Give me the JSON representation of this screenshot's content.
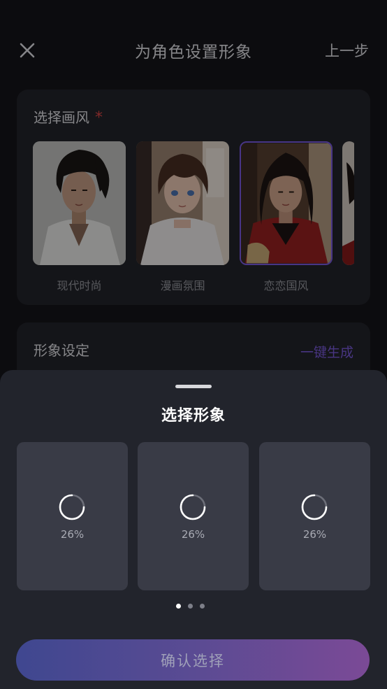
{
  "header": {
    "title": "为角色设置形象",
    "prev_label": "上一步"
  },
  "style_section": {
    "title": "选择画风",
    "required_mark": "*",
    "styles": [
      {
        "label": "现代时尚",
        "selected": false
      },
      {
        "label": "漫画氛围",
        "selected": false
      },
      {
        "label": "恋恋国风",
        "selected": true
      }
    ]
  },
  "appearance_section": {
    "title": "形象设定",
    "generate_label": "一键生成"
  },
  "sheet": {
    "title": "选择形象",
    "options": [
      {
        "progress": "26%"
      },
      {
        "progress": "26%"
      },
      {
        "progress": "26%"
      }
    ],
    "page_dots": {
      "count": 3,
      "active": 0
    },
    "confirm_label": "确认选择"
  },
  "colors": {
    "accent": "#7c5ce0",
    "required": "#e04848",
    "button_gradient_start": "#3f4790",
    "button_gradient_end": "#7b4a96"
  },
  "icons": [
    "close-icon",
    "loading-spinner-icon"
  ]
}
